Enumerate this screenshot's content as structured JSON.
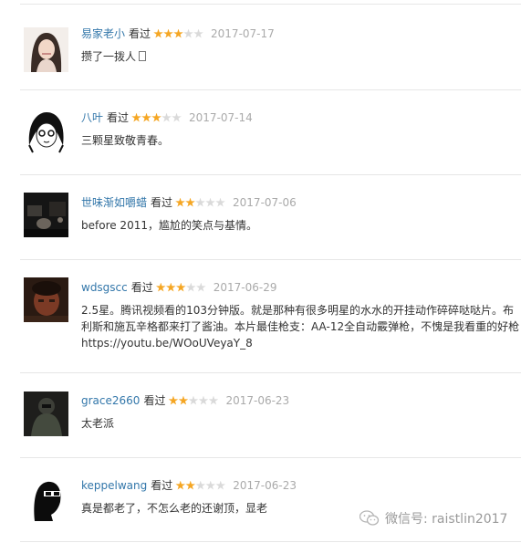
{
  "comments": [
    {
      "user": "易家老小",
      "watched": "看过",
      "rating": 3,
      "date": "2017-07-17",
      "text": [
        "攒了一拨人"
      ],
      "trailing_box": true,
      "avatar": "woman"
    },
    {
      "user": "八叶",
      "watched": "看过",
      "rating": 3,
      "date": "2017-07-14",
      "text": [
        "三颗星致敬青春。"
      ],
      "avatar": "sketch"
    },
    {
      "user": "世味渐如嚼蜡",
      "watched": "看过",
      "rating": 2,
      "date": "2017-07-06",
      "text": [
        "before 2011，尴尬的笑点与基情。"
      ],
      "avatar": "room"
    },
    {
      "user": "wdsgscc",
      "watched": "看过",
      "rating": 3,
      "date": "2017-06-29",
      "text": [
        "2.5星。腾讯视频看的103分钟版。就是那种有很多明星的水水的开挂动作碎碎哒哒片。布",
        "利斯和施瓦辛格都来打了酱油。本片最佳枪支：AA-12全自动霰弹枪，不愧是我看重的好枪",
        "https://youtu.be/WOoUVeyaY_8"
      ],
      "avatar": "face"
    },
    {
      "user": "grace2660",
      "watched": "看过",
      "rating": 2,
      "date": "2017-06-23",
      "text": [
        "太老派"
      ],
      "avatar": "soldier"
    },
    {
      "user": "keppelwang",
      "watched": "看过",
      "rating": 2,
      "date": "2017-06-23",
      "text": [
        "真是都老了，不怎么老的还谢顶，显老"
      ],
      "avatar": "silhouette"
    }
  ],
  "watermark": {
    "text": "微信号: raistlin2017",
    "icon": "wechat-icon"
  },
  "colors": {
    "username": "#3377aa",
    "star_on": "#f5a623",
    "star_off": "#dadada",
    "date": "#aaaaaa"
  }
}
